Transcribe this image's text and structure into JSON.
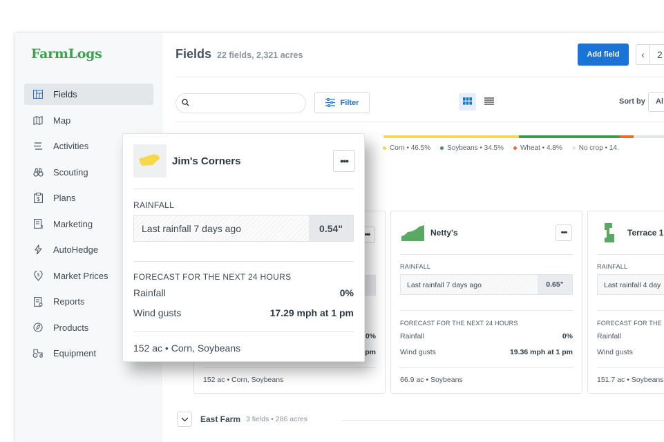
{
  "app": {
    "logo": "FarmLogs"
  },
  "sidebar": {
    "items": [
      {
        "label": "Fields",
        "icon": "fields-icon",
        "active": true
      },
      {
        "label": "Map",
        "icon": "map-icon"
      },
      {
        "label": "Activities",
        "icon": "activities-icon"
      },
      {
        "label": "Scouting",
        "icon": "binoculars-icon"
      },
      {
        "label": "Plans",
        "icon": "plans-icon"
      },
      {
        "label": "Marketing",
        "icon": "marketing-icon"
      },
      {
        "label": "AutoHedge",
        "icon": "autohedge-icon"
      },
      {
        "label": "Market Prices",
        "icon": "market-prices-icon"
      },
      {
        "label": "Reports",
        "icon": "reports-icon"
      },
      {
        "label": "Products",
        "icon": "products-icon"
      },
      {
        "label": "Equipment",
        "icon": "equipment-icon"
      }
    ]
  },
  "header": {
    "title": "Fields",
    "subtitle": "22 fields, 2,321 acres",
    "add_button": "Add field",
    "page_prev": "‹",
    "page_number": "2"
  },
  "toolbar": {
    "search_placeholder": "",
    "filter_label": "Filter",
    "sort_label": "Sort by",
    "sort_value": "Al"
  },
  "crop_summary": {
    "items": [
      {
        "label": "Corn • 46.5%",
        "color": "#f6d84a",
        "share": 46.5
      },
      {
        "label": "Soybeans • 34.5%",
        "color": "#3d9a48",
        "share": 34.5
      },
      {
        "label": "Wheat • 4.8%",
        "color": "#f06a2a",
        "share": 4.8
      },
      {
        "label": "No crop • 14.",
        "color": "#e3e5e8",
        "share": 14.2
      }
    ]
  },
  "cards": [
    {
      "name": "Netty's",
      "rain_label": "RAINFALL",
      "last_rain": "Last rainfall 7 days ago",
      "rain_value": "0.65\"",
      "forecast_label": "FORECAST FOR THE NEXT 24 HOURS",
      "rainfall_label": "Rainfall",
      "rainfall_value": "0%",
      "wind_label": "Wind gusts",
      "wind_value": "19.36 mph at 1 pm",
      "footer": "66.9 ac • Soybeans"
    },
    {
      "name": "Terrace 1",
      "rain_label": "RAINFALL",
      "last_rain": "Last rainfall 4 day",
      "rain_value": "",
      "forecast_label": "FORECAST FOR THE N",
      "rainfall_label": "Rainfall",
      "rainfall_value": "",
      "wind_label": "Wind gusts",
      "wind_value": "",
      "footer": "151.7 ac • Soybeans"
    }
  ],
  "hidden_card": {
    "rain_value": "5\"",
    "rainfall_value": "0%",
    "wind_value": "pm",
    "footer": "152 ac • Corn, Soybeans"
  },
  "farm_group": {
    "name": "East Farm",
    "sub": "3 fields • 286 acres"
  },
  "popup": {
    "name": "Jim's Corners",
    "menu": "•••",
    "rain_label": "RAINFALL",
    "last_rain": "Last rainfall 7 days ago",
    "rain_value": "0.54\"",
    "forecast_label": "FORECAST FOR THE NEXT 24 HOURS",
    "rainfall_label": "Rainfall",
    "rainfall_value": "0%",
    "wind_label": "Wind gusts",
    "wind_value": "17.29 mph at 1 pm",
    "footer": "152 ac • Corn, Soybeans"
  },
  "card_menu": "•••"
}
